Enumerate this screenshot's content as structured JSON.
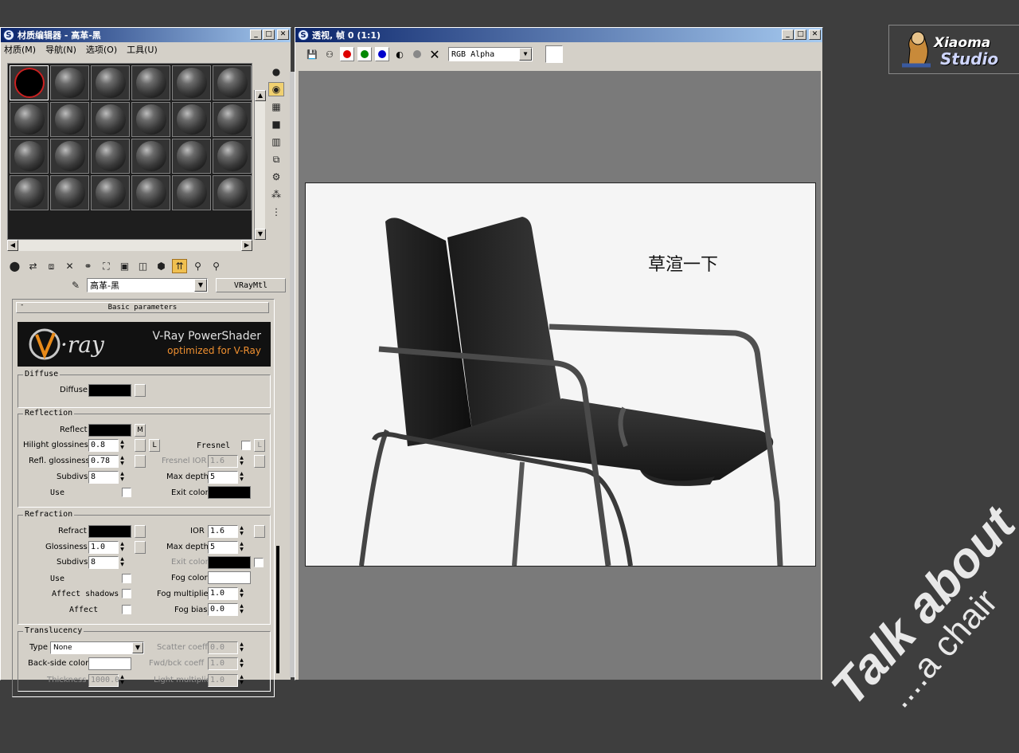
{
  "mat_editor": {
    "title": "材质编辑器 - 高革-黑",
    "menu": [
      "材质(M)",
      "导航(N)",
      "选项(O)",
      "工具(U)"
    ],
    "material_name": "高革-黑",
    "material_type": "VRayMtl",
    "rollout_title": "Basic parameters",
    "vray_banner": {
      "title": "V-Ray PowerShader",
      "subtitle": "optimized for V-Ray"
    },
    "diffuse": {
      "group": "Diffuse",
      "label": "Diffuse"
    },
    "reflection": {
      "group": "Reflection",
      "reflect_label": "Reflect",
      "map_btn": "M",
      "hilight_label": "Hilight glossiness",
      "hilight_value": "0.8",
      "lock_btn": "L",
      "fresnel_label": "Fresnel",
      "refl_gloss_label": "Refl. glossiness",
      "refl_gloss_value": "0.78",
      "fresnel_ior_label": "Fresnel IOR",
      "fresnel_ior_value": "1.6",
      "subdivs_label": "Subdivs",
      "subdivs_value": "8",
      "max_depth_label": "Max depth",
      "max_depth_value": "5",
      "use_label": "Use",
      "exit_color_label": "Exit color"
    },
    "refraction": {
      "group": "Refraction",
      "refract_label": "Refract",
      "ior_label": "IOR",
      "ior_value": "1.6",
      "gloss_label": "Glossiness",
      "gloss_value": "1.0",
      "max_depth_label": "Max depth",
      "max_depth_value": "5",
      "subdivs_label": "Subdivs",
      "subdivs_value": "8",
      "exit_color_label": "Exit color",
      "use_label": "Use",
      "fog_color_label": "Fog color",
      "affect_shadows_label": "Affect shadows",
      "fog_mult_label": "Fog multiplier",
      "fog_mult_value": "1.0",
      "affect_label": "Affect",
      "fog_bias_label": "Fog bias",
      "fog_bias_value": "0.0"
    },
    "translucency": {
      "group": "Translucency",
      "type_label": "Type",
      "type_value": "None",
      "scatter_label": "Scatter coeff",
      "scatter_value": "0.0",
      "backside_label": "Back-side color",
      "fwd_label": "Fwd/bck coeff",
      "fwd_value": "1.0",
      "thickness_label": "Thickness",
      "thickness_value": "1000.0",
      "light_mult_label": "Light multiplier",
      "light_mult_value": "1.0"
    }
  },
  "render_window": {
    "title": "透视, 帧 0 (1:1)",
    "channel": "RGB Alpha",
    "caption": "草渲一下"
  },
  "logo": {
    "line1": "Xiaoma",
    "line2": "Studio"
  },
  "watermark": {
    "line1": "Talk about",
    "line2": "....a chair"
  },
  "colors": {
    "title_start": "#0a246a",
    "title_end": "#a6caf0",
    "desktop": "#3e3e3e",
    "window": "#d4d0c8"
  }
}
